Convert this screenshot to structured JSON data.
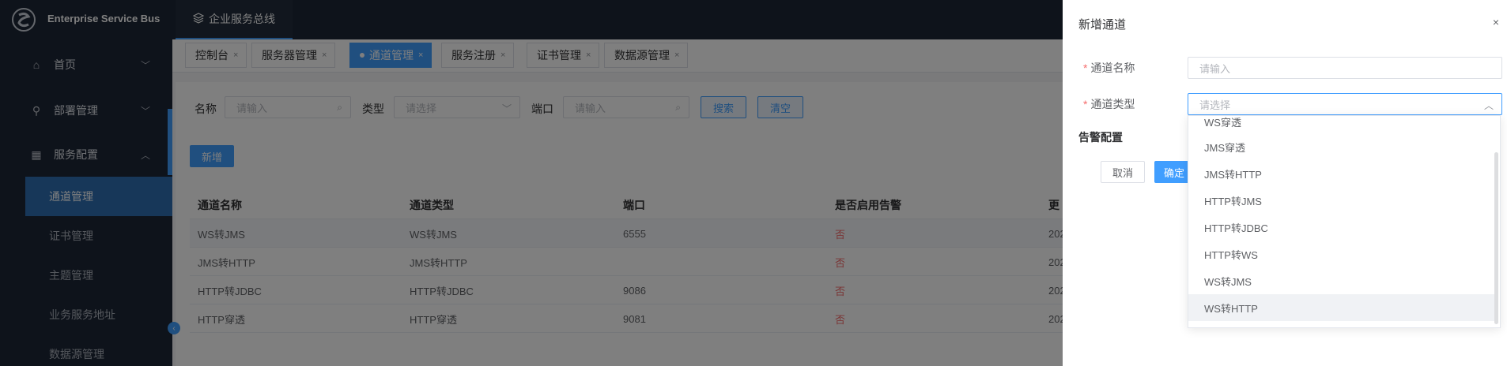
{
  "header": {
    "brand": "Enterprise Service Bus",
    "system_tab": "企业服务总线"
  },
  "sidebar": {
    "menus": [
      {
        "label": "首页"
      },
      {
        "label": "部署管理"
      },
      {
        "label": "服务配置"
      }
    ],
    "submenus": [
      {
        "label": "通道管理"
      },
      {
        "label": "证书管理"
      },
      {
        "label": "主题管理"
      },
      {
        "label": "业务服务地址"
      },
      {
        "label": "数据源管理"
      }
    ]
  },
  "tabs": [
    {
      "label": "控制台"
    },
    {
      "label": "服务器管理"
    },
    {
      "label": "通道管理"
    },
    {
      "label": "服务注册"
    },
    {
      "label": "证书管理"
    },
    {
      "label": "数据源管理"
    }
  ],
  "filters": {
    "name_label": "名称",
    "name_placeholder": "请输入",
    "type_label": "类型",
    "type_placeholder": "请选择",
    "port_label": "端口",
    "port_placeholder": "请输入",
    "search": "搜索",
    "clear": "清空"
  },
  "add_button": "新增",
  "table": {
    "headers": [
      "通道名称",
      "通道类型",
      "端口",
      "是否启用告警",
      "更"
    ],
    "rows": [
      [
        "WS转JMS",
        "WS转JMS",
        "6555",
        "否",
        "202"
      ],
      [
        "JMS转HTTP",
        "JMS转HTTP",
        "",
        "否",
        "202"
      ],
      [
        "HTTP转JDBC",
        "HTTP转JDBC",
        "9086",
        "否",
        "202"
      ],
      [
        "HTTP穿透",
        "HTTP穿透",
        "9081",
        "否",
        "202"
      ]
    ]
  },
  "drawer": {
    "title": "新增通道",
    "close": "×",
    "name_label": "通道名称",
    "name_placeholder": "请输入",
    "type_label": "通道类型",
    "type_placeholder": "请选择",
    "alarm_section": "告警配置",
    "cancel": "取消",
    "confirm": "确定"
  },
  "dropdown_options": [
    "WS穿透",
    "JMS穿透",
    "JMS转HTTP",
    "HTTP转JMS",
    "HTTP转JDBC",
    "HTTP转WS",
    "WS转JMS",
    "WS转HTTP"
  ],
  "colors": {
    "primary": "#409eff",
    "sidebar_bg": "#1d2636",
    "danger": "#f56c6c"
  }
}
